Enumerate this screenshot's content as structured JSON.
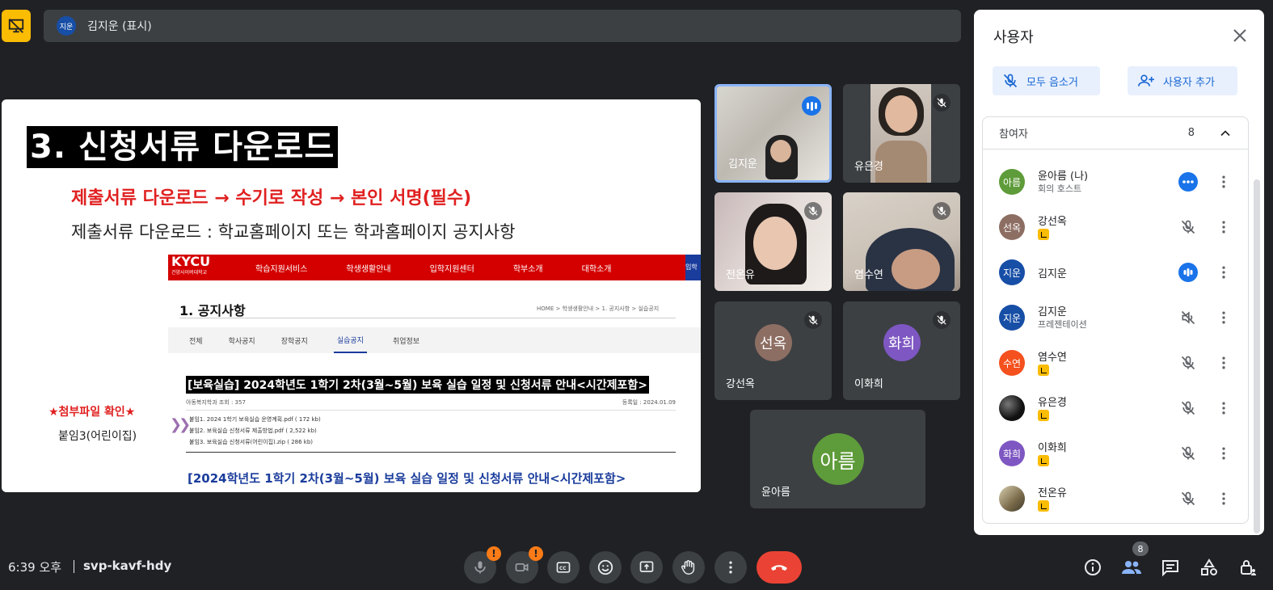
{
  "presenter": {
    "avatar": "지운",
    "label": "김지운 (표시)"
  },
  "slide": {
    "heading": "3. 신청서류 다운로드",
    "red_line": "제출서류 다운로드 → 수기로 작성 → 본인 서명(필수)",
    "sub_line": "제출서류 다운로드 : 학교홈페이지 또는 학과홈페이지 공지사항",
    "site": {
      "logo": "KYCU",
      "logo_sub": "건양사이버대학교",
      "nav": [
        "학습지원서비스",
        "학생생활안내",
        "입학지원센터",
        "학부소개",
        "대학소개"
      ],
      "nav_extra": "입학",
      "page_title": "1. 공지사항",
      "breadcrumb": "HOME > 학생생활안내 > 1. 공지사항 > 실습공지",
      "tabs": [
        "전체",
        "학사공지",
        "장학공지",
        "실습공지",
        "취업정보"
      ],
      "post_title": "[보육실습] 2024학년도 1학기 2차(3월~5월) 보육 실습 일정 및 신청서류 안내<시간제포함>",
      "meta_left": "아동복지학과   조회 : 357",
      "meta_right": "등록일 : 2024.01.09",
      "attachments": [
        "붙임1. 2024 1학기 보육실습 운영계획.pdf ( 172 kb)",
        "붙임2. 보육실습 신청서류 제출방법.pdf ( 2,522 kb)",
        "붙임3. 보육실습 신청서류(어린이집).zip ( 286 kb)"
      ],
      "post_bottom": "[2024학년도 1학기 2차(3월~5월) 보육 실습 일정 및 신청서류 안내<시간제포함>"
    },
    "attach_note": "★첨부파일 확인★",
    "attach_name": "붙임3(어린이집)"
  },
  "tiles": [
    {
      "name": "김지운"
    },
    {
      "name": "유은경"
    },
    {
      "name": "전온유"
    },
    {
      "name": "염수연"
    },
    {
      "name": "강선옥",
      "avatar": "선옥"
    },
    {
      "name": "이화희",
      "avatar": "화희"
    },
    {
      "name": "윤아름",
      "avatar": "아름"
    }
  ],
  "panel": {
    "title": "사용자",
    "mute_all": "모두 음소거",
    "add_user": "사용자 추가",
    "section": "참여자",
    "count": "8",
    "people": [
      {
        "avatar": "아름",
        "name": "윤아름 (나)",
        "sub": "회의 호스트",
        "color": "#5e9b3a"
      },
      {
        "avatar": "선옥",
        "name": "강선옥",
        "color": "#8d6e63"
      },
      {
        "avatar": "지운",
        "name": "김지운",
        "color": "#174ea6"
      },
      {
        "avatar": "지운",
        "name": "김지운",
        "sub": "프레젠테이션",
        "color": "#174ea6"
      },
      {
        "avatar": "수연",
        "name": "염수연",
        "color": "#f4511e"
      },
      {
        "avatar": "",
        "name": "유은경",
        "color": "#111111"
      },
      {
        "avatar": "화희",
        "name": "이화희",
        "color": "#7e57c2"
      },
      {
        "avatar": "",
        "name": "전온유",
        "color": "#7a6a4a"
      }
    ]
  },
  "bottom": {
    "time": "6:39 오후",
    "code": "svp-kavf-hdy",
    "people_count": "8",
    "warn": "!"
  }
}
